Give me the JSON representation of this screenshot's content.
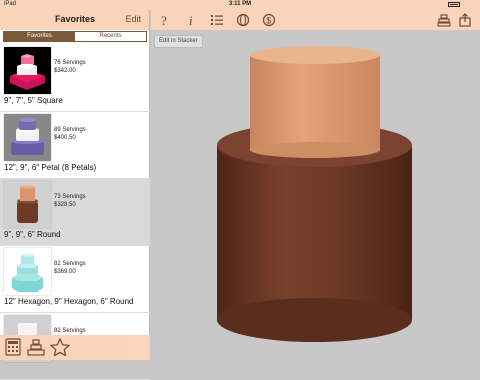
{
  "status": {
    "carrier": "iPad",
    "time": "3:11 PM",
    "battery": ""
  },
  "sidebar": {
    "title": "Favorites",
    "edit_label": "Edit",
    "segments": [
      "Favorites",
      "Recents"
    ],
    "items": [
      {
        "servings": "76 Servings",
        "price": "$342.00",
        "caption": "9\", 7\", 5\" Square",
        "colors": [
          "#e81a5e",
          "#ffffff",
          "#f16fa0"
        ]
      },
      {
        "servings": "89 Servings",
        "price": "$400.50",
        "caption": "12\", 9\", 6\" Petal (8 Petals)",
        "colors": [
          "#6a5aa8",
          "#f2f2f2",
          "#7b69b5"
        ]
      },
      {
        "servings": "73 Servings",
        "price": "$328.50",
        "caption": "9\", 9\", 6\" Round",
        "colors": [
          "#6e3a28",
          "#d79a72"
        ]
      },
      {
        "servings": "82 Servings",
        "price": "$369.00",
        "caption": "12\" Hexagon, 9\" Hexagon, 6\" Round",
        "colors": [
          "#8fe0e0",
          "#a8e6e6",
          "#bdebeb"
        ]
      },
      {
        "servings": "82 Servings",
        "price": "",
        "caption": "",
        "colors": [
          "#e8e8e8"
        ]
      }
    ]
  },
  "canvas": {
    "stacker_label": "Edit in Stacker",
    "top_color": "#d9956c",
    "bottom_color": "#6e3a28"
  }
}
